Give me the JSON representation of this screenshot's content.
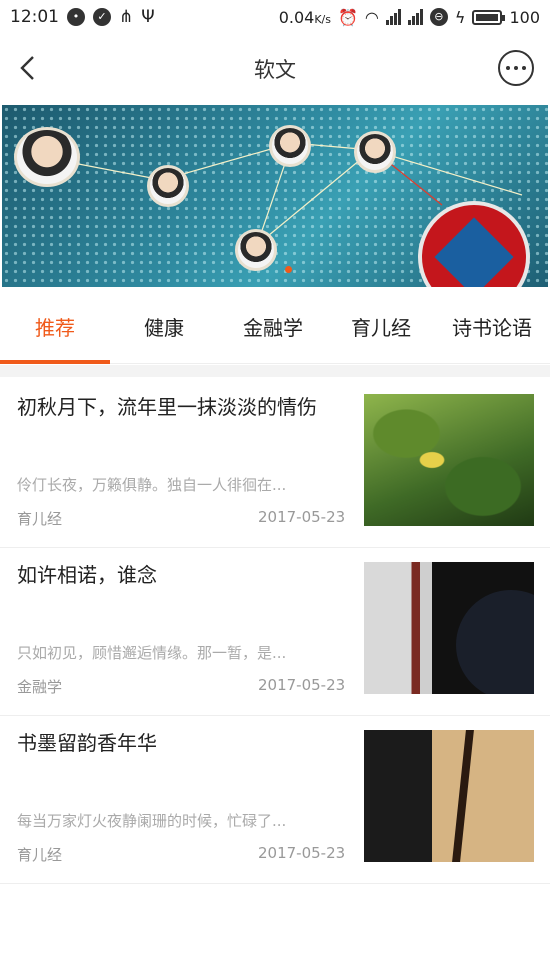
{
  "status": {
    "time": "12:01",
    "speed": "0.04",
    "speed_unit": "K/s",
    "battery": "100"
  },
  "nav": {
    "title": "软文"
  },
  "tabs": [
    {
      "label": "推荐",
      "active": true
    },
    {
      "label": "健康",
      "active": false
    },
    {
      "label": "金融学",
      "active": false
    },
    {
      "label": "育儿经",
      "active": false
    },
    {
      "label": "诗书论语",
      "active": false
    }
  ],
  "articles": [
    {
      "title": "初秋月下，流年里一抹淡淡的情伤",
      "summary": "伶仃长夜，万籁俱静。独自一人徘徊在...",
      "tag": "育儿经",
      "date": "2017-05-23",
      "thumb": "leaf"
    },
    {
      "title": "如许相诺，谁念",
      "summary": "只如初见，顾惜邂逅情缘。那一暂，是...",
      "tag": "金融学",
      "date": "2017-05-23",
      "thumb": "panel1"
    },
    {
      "title": "书墨留韵香年华",
      "summary": "每当万家灯火夜静阑珊的时候，忙碌了...",
      "tag": "育儿经",
      "date": "2017-05-23",
      "thumb": "panel2"
    }
  ],
  "colors": {
    "accent": "#f05a1a"
  }
}
